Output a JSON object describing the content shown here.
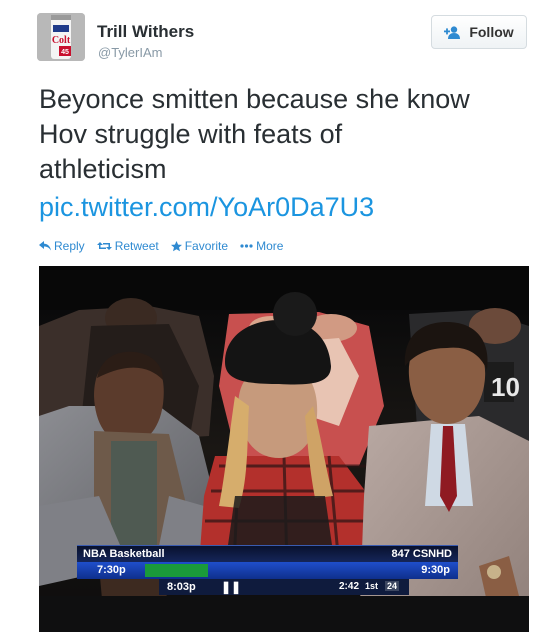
{
  "author": {
    "name": "Trill Withers",
    "handle": "@TylerIAm",
    "avatar_icon": "avatar-beer-can"
  },
  "follow": {
    "label": "Follow",
    "icon": "add-user-icon"
  },
  "tweet": {
    "lines": [
      "Beyonce smitten because she know",
      "Hov struggle with feats of",
      "athleticism"
    ],
    "link": "pic.twitter.com/YoAr0Da7U3"
  },
  "actions": [
    {
      "label": "Reply",
      "icon": "reply-icon"
    },
    {
      "label": "Retweet",
      "icon": "retweet-icon"
    },
    {
      "label": "Favorite",
      "icon": "star-icon"
    },
    {
      "label": "More",
      "icon": "more-dots-icon"
    }
  ],
  "photo": {
    "scoreboard": {
      "league": "NBA Basketball",
      "channel": "847 CSNHD",
      "start_time": "7:30p",
      "end_time": "9:30p",
      "current_time": "8:03p",
      "game_clock": "2:42",
      "period": "1st",
      "shot_clock": "24"
    }
  },
  "colors": {
    "link": "#1b95e0",
    "action": "#2f8ad1",
    "text": "#292f33",
    "muted": "#8899a6"
  }
}
